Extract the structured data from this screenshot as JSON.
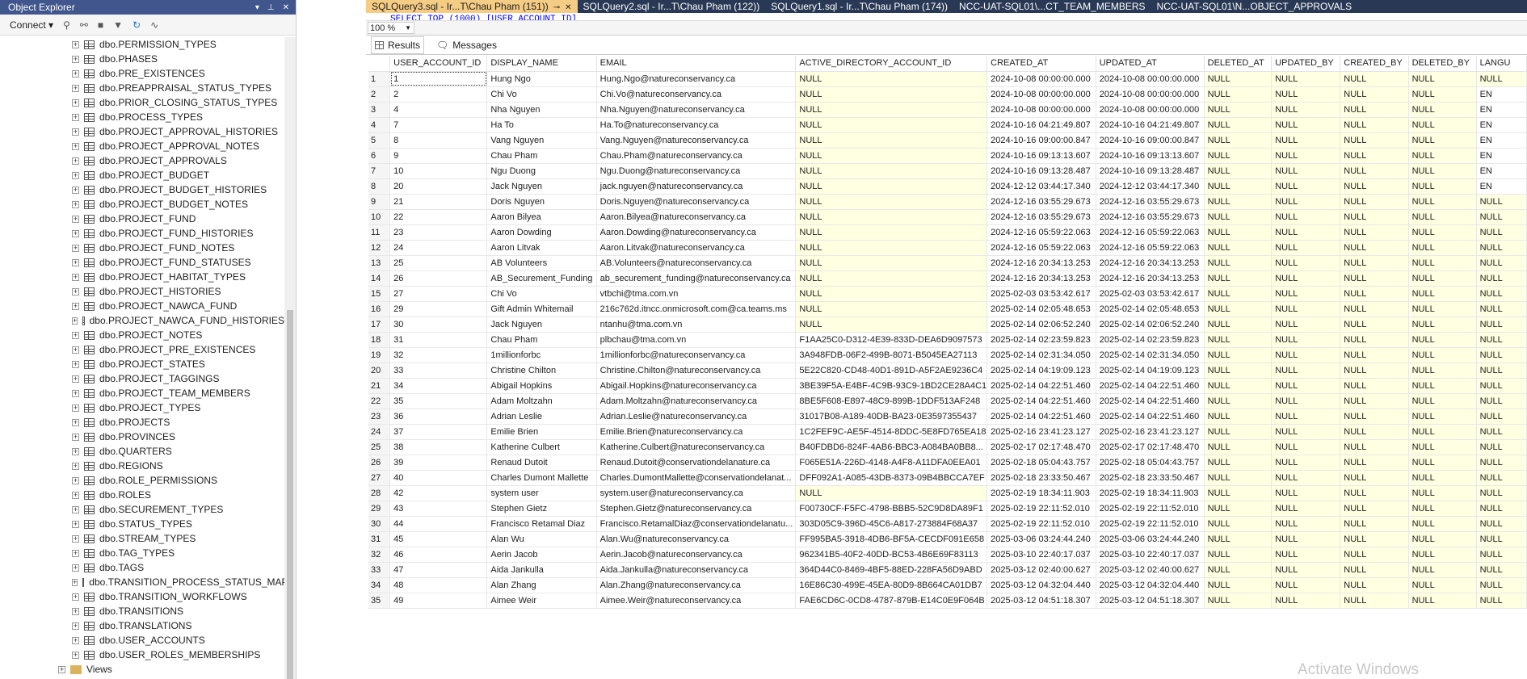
{
  "object_explorer": {
    "title": "Object Explorer",
    "connect_label": "Connect",
    "tables": [
      "dbo.PERMISSION_TYPES",
      "dbo.PHASES",
      "dbo.PRE_EXISTENCES",
      "dbo.PREAPPRAISAL_STATUS_TYPES",
      "dbo.PRIOR_CLOSING_STATUS_TYPES",
      "dbo.PROCESS_TYPES",
      "dbo.PROJECT_APPROVAL_HISTORIES",
      "dbo.PROJECT_APPROVAL_NOTES",
      "dbo.PROJECT_APPROVALS",
      "dbo.PROJECT_BUDGET",
      "dbo.PROJECT_BUDGET_HISTORIES",
      "dbo.PROJECT_BUDGET_NOTES",
      "dbo.PROJECT_FUND",
      "dbo.PROJECT_FUND_HISTORIES",
      "dbo.PROJECT_FUND_NOTES",
      "dbo.PROJECT_FUND_STATUSES",
      "dbo.PROJECT_HABITAT_TYPES",
      "dbo.PROJECT_HISTORIES",
      "dbo.PROJECT_NAWCA_FUND",
      "dbo.PROJECT_NAWCA_FUND_HISTORIES",
      "dbo.PROJECT_NOTES",
      "dbo.PROJECT_PRE_EXISTENCES",
      "dbo.PROJECT_STATES",
      "dbo.PROJECT_TAGGINGS",
      "dbo.PROJECT_TEAM_MEMBERS",
      "dbo.PROJECT_TYPES",
      "dbo.PROJECTS",
      "dbo.PROVINCES",
      "dbo.QUARTERS",
      "dbo.REGIONS",
      "dbo.ROLE_PERMISSIONS",
      "dbo.ROLES",
      "dbo.SECUREMENT_TYPES",
      "dbo.STATUS_TYPES",
      "dbo.STREAM_TYPES",
      "dbo.TAG_TYPES",
      "dbo.TAGS",
      "dbo.TRANSITION_PROCESS_STATUS_MAPPINGS",
      "dbo.TRANSITION_WORKFLOWS",
      "dbo.TRANSITIONS",
      "dbo.TRANSLATIONS",
      "dbo.USER_ACCOUNTS",
      "dbo.USER_ROLES_MEMBERSHIPS"
    ],
    "views_label": "Views"
  },
  "tabs": [
    {
      "label": "SQLQuery3.sql - Ir...T\\Chau Pham (151))",
      "active": true
    },
    {
      "label": "SQLQuery2.sql - Ir...T\\Chau Pham (122))",
      "active": false
    },
    {
      "label": "SQLQuery1.sql - Ir...T\\Chau Pham (174))",
      "active": false
    },
    {
      "label": "NCC-UAT-SQL01\\...CT_TEAM_MEMBERS",
      "active": false
    },
    {
      "label": "NCC-UAT-SQL01\\N...OBJECT_APPROVALS",
      "active": false
    }
  ],
  "editor_text": "SELECT TOP (1000) [USER_ACCOUNT_ID]",
  "zoom": "100 %",
  "result_tabs": {
    "results": "Results",
    "messages": "Messages"
  },
  "grid": {
    "columns": [
      "USER_ACCOUNT_ID",
      "DISPLAY_NAME",
      "EMAIL",
      "ACTIVE_DIRECTORY_ACCOUNT_ID",
      "CREATED_AT",
      "UPDATED_AT",
      "DELETED_AT",
      "UPDATED_BY",
      "CREATED_BY",
      "DELETED_BY",
      "LANGU"
    ],
    "rows": [
      [
        "1",
        "Hung Ngo",
        "Hung.Ngo@natureconservancy.ca",
        "NULL",
        "2024-10-08 00:00:00.000",
        "2024-10-08 00:00:00.000",
        "NULL",
        "NULL",
        "NULL",
        "NULL",
        "NULL"
      ],
      [
        "2",
        "Chi Vo",
        "Chi.Vo@natureconservancy.ca",
        "NULL",
        "2024-10-08 00:00:00.000",
        "2024-10-08 00:00:00.000",
        "NULL",
        "NULL",
        "NULL",
        "NULL",
        "EN"
      ],
      [
        "4",
        "Nha Nguyen",
        "Nha.Nguyen@natureconservancy.ca",
        "NULL",
        "2024-10-08 00:00:00.000",
        "2024-10-08 00:00:00.000",
        "NULL",
        "NULL",
        "NULL",
        "NULL",
        "EN"
      ],
      [
        "7",
        "Ha To",
        "Ha.To@natureconservancy.ca",
        "NULL",
        "2024-10-16 04:21:49.807",
        "2024-10-16 04:21:49.807",
        "NULL",
        "NULL",
        "NULL",
        "NULL",
        "EN"
      ],
      [
        "8",
        "Vang Nguyen",
        "Vang.Nguyen@natureconservancy.ca",
        "NULL",
        "2024-10-16 09:00:00.847",
        "2024-10-16 09:00:00.847",
        "NULL",
        "NULL",
        "NULL",
        "NULL",
        "EN"
      ],
      [
        "9",
        "Chau Pham",
        "Chau.Pham@natureconservancy.ca",
        "NULL",
        "2024-10-16 09:13:13.607",
        "2024-10-16 09:13:13.607",
        "NULL",
        "NULL",
        "NULL",
        "NULL",
        "EN"
      ],
      [
        "10",
        "Ngu Duong",
        "Ngu.Duong@natureconservancy.ca",
        "NULL",
        "2024-10-16 09:13:28.487",
        "2024-10-16 09:13:28.487",
        "NULL",
        "NULL",
        "NULL",
        "NULL",
        "EN"
      ],
      [
        "20",
        "Jack Nguyen",
        "jack.nguyen@natureconservancy.ca",
        "NULL",
        "2024-12-12 03:44:17.340",
        "2024-12-12 03:44:17.340",
        "NULL",
        "NULL",
        "NULL",
        "NULL",
        "EN"
      ],
      [
        "21",
        "Doris Nguyen",
        "Doris.Nguyen@natureconservancy.ca",
        "NULL",
        "2024-12-16 03:55:29.673",
        "2024-12-16 03:55:29.673",
        "NULL",
        "NULL",
        "NULL",
        "NULL",
        "NULL"
      ],
      [
        "22",
        "Aaron Bilyea",
        "Aaron.Bilyea@natureconservancy.ca",
        "NULL",
        "2024-12-16 03:55:29.673",
        "2024-12-16 03:55:29.673",
        "NULL",
        "NULL",
        "NULL",
        "NULL",
        "NULL"
      ],
      [
        "23",
        "Aaron Dowding",
        "Aaron.Dowding@natureconservancy.ca",
        "NULL",
        "2024-12-16 05:59:22.063",
        "2024-12-16 05:59:22.063",
        "NULL",
        "NULL",
        "NULL",
        "NULL",
        "NULL"
      ],
      [
        "24",
        "Aaron Litvak",
        "Aaron.Litvak@natureconservancy.ca",
        "NULL",
        "2024-12-16 05:59:22.063",
        "2024-12-16 05:59:22.063",
        "NULL",
        "NULL",
        "NULL",
        "NULL",
        "NULL"
      ],
      [
        "25",
        "AB Volunteers",
        "AB.Volunteers@natureconservancy.ca",
        "NULL",
        "2024-12-16 20:34:13.253",
        "2024-12-16 20:34:13.253",
        "NULL",
        "NULL",
        "NULL",
        "NULL",
        "NULL"
      ],
      [
        "26",
        "AB_Securement_Funding",
        "ab_securement_funding@natureconservancy.ca",
        "NULL",
        "2024-12-16 20:34:13.253",
        "2024-12-16 20:34:13.253",
        "NULL",
        "NULL",
        "NULL",
        "NULL",
        "NULL"
      ],
      [
        "27",
        "Chi Vo",
        "vtbchi@tma.com.vn",
        "NULL",
        "2025-02-03 03:53:42.617",
        "2025-02-03 03:53:42.617",
        "NULL",
        "NULL",
        "NULL",
        "NULL",
        "NULL"
      ],
      [
        "29",
        "Gift Admin Whitemail",
        "216c762d.itncc.onmicrosoft.com@ca.teams.ms",
        "NULL",
        "2025-02-14 02:05:48.653",
        "2025-02-14 02:05:48.653",
        "NULL",
        "NULL",
        "NULL",
        "NULL",
        "NULL"
      ],
      [
        "30",
        "Jack Nguyen",
        "ntanhu@tma.com.vn",
        "NULL",
        "2025-02-14 02:06:52.240",
        "2025-02-14 02:06:52.240",
        "NULL",
        "NULL",
        "NULL",
        "NULL",
        "NULL"
      ],
      [
        "31",
        "Chau Pham",
        "plbchau@tma.com.vn",
        "F1AA25C0-D312-4E39-833D-DEA6D9097573",
        "2025-02-14 02:23:59.823",
        "2025-02-14 02:23:59.823",
        "NULL",
        "NULL",
        "NULL",
        "NULL",
        "NULL"
      ],
      [
        "32",
        "1millionforbc",
        "1millionforbc@natureconservancy.ca",
        "3A948FDB-06F2-499B-8071-B5045EA27113",
        "2025-02-14 02:31:34.050",
        "2025-02-14 02:31:34.050",
        "NULL",
        "NULL",
        "NULL",
        "NULL",
        "NULL"
      ],
      [
        "33",
        "Christine Chilton",
        "Christine.Chilton@natureconservancy.ca",
        "5E22C820-CD48-40D1-891D-A5F2AE9236C4",
        "2025-02-14 04:19:09.123",
        "2025-02-14 04:19:09.123",
        "NULL",
        "NULL",
        "NULL",
        "NULL",
        "NULL"
      ],
      [
        "34",
        "Abigail Hopkins",
        "Abigail.Hopkins@natureconservancy.ca",
        "3BE39F5A-E4BF-4C9B-93C9-1BD2CE28A4C1",
        "2025-02-14 04:22:51.460",
        "2025-02-14 04:22:51.460",
        "NULL",
        "NULL",
        "NULL",
        "NULL",
        "NULL"
      ],
      [
        "35",
        "Adam Moltzahn",
        "Adam.Moltzahn@natureconservancy.ca",
        "8BE5F608-E897-48C9-899B-1DDF513AF248",
        "2025-02-14 04:22:51.460",
        "2025-02-14 04:22:51.460",
        "NULL",
        "NULL",
        "NULL",
        "NULL",
        "NULL"
      ],
      [
        "36",
        "Adrian Leslie",
        "Adrian.Leslie@natureconservancy.ca",
        "31017B08-A189-40DB-BA23-0E3597355437",
        "2025-02-14 04:22:51.460",
        "2025-02-14 04:22:51.460",
        "NULL",
        "NULL",
        "NULL",
        "NULL",
        "NULL"
      ],
      [
        "37",
        "Emilie Brien",
        "Emilie.Brien@natureconservancy.ca",
        "1C2FEF9C-AE5F-4514-8DDC-5E8FD765EA18",
        "2025-02-16 23:41:23.127",
        "2025-02-16 23:41:23.127",
        "NULL",
        "NULL",
        "NULL",
        "NULL",
        "NULL"
      ],
      [
        "38",
        "Katherine Culbert",
        "Katherine.Culbert@natureconservancy.ca",
        "B40FDBD6-824F-4AB6-BBC3-A084BA0BB8...",
        "2025-02-17 02:17:48.470",
        "2025-02-17 02:17:48.470",
        "NULL",
        "NULL",
        "NULL",
        "NULL",
        "NULL"
      ],
      [
        "39",
        "Renaud Dutoit",
        "Renaud.Dutoit@conservationdelanature.ca",
        "F065E51A-226D-4148-A4F8-A11DFA0EEA01",
        "2025-02-18 05:04:43.757",
        "2025-02-18 05:04:43.757",
        "NULL",
        "NULL",
        "NULL",
        "NULL",
        "NULL"
      ],
      [
        "40",
        "Charles Dumont Mallette",
        "Charles.DumontMallette@conservationdelanat...",
        "DFF092A1-A085-43DB-8373-09B4BBCCA7EF",
        "2025-02-18 23:33:50.467",
        "2025-02-18 23:33:50.467",
        "NULL",
        "NULL",
        "NULL",
        "NULL",
        "NULL"
      ],
      [
        "42",
        "system user",
        "system.user@natureconservancy.ca",
        "NULL",
        "2025-02-19 18:34:11.903",
        "2025-02-19 18:34:11.903",
        "NULL",
        "NULL",
        "NULL",
        "NULL",
        "NULL"
      ],
      [
        "43",
        "Stephen Gietz",
        "Stephen.Gietz@natureconservancy.ca",
        "F00730CF-F5FC-4798-BBB5-52C9D8DA89F1",
        "2025-02-19 22:11:52.010",
        "2025-02-19 22:11:52.010",
        "NULL",
        "NULL",
        "NULL",
        "NULL",
        "NULL"
      ],
      [
        "44",
        "Francisco Retamal Diaz",
        "Francisco.RetamalDiaz@conservationdelanatu...",
        "303D05C9-396D-45C6-A817-273884F68A37",
        "2025-02-19 22:11:52.010",
        "2025-02-19 22:11:52.010",
        "NULL",
        "NULL",
        "NULL",
        "NULL",
        "NULL"
      ],
      [
        "45",
        "Alan Wu",
        "Alan.Wu@natureconservancy.ca",
        "FF995BA5-3918-4DB6-BF5A-CECDF091E658",
        "2025-03-06 03:24:44.240",
        "2025-03-06 03:24:44.240",
        "NULL",
        "NULL",
        "NULL",
        "NULL",
        "NULL"
      ],
      [
        "46",
        "Aerin Jacob",
        "Aerin.Jacob@natureconservancy.ca",
        "962341B5-40F2-40DD-BC53-4B6E69F83113",
        "2025-03-10 22:40:17.037",
        "2025-03-10 22:40:17.037",
        "NULL",
        "NULL",
        "NULL",
        "NULL",
        "NULL"
      ],
      [
        "47",
        "Aida Jankulla",
        "Aida.Jankulla@natureconservancy.ca",
        "364D44C0-8469-4BF5-88ED-228FA56D9ABD",
        "2025-03-12 02:40:00.627",
        "2025-03-12 02:40:00.627",
        "NULL",
        "NULL",
        "NULL",
        "NULL",
        "NULL"
      ],
      [
        "48",
        "Alan Zhang",
        "Alan.Zhang@natureconservancy.ca",
        "16E86C30-499E-45EA-80D9-8B664CA01DB7",
        "2025-03-12 04:32:04.440",
        "2025-03-12 04:32:04.440",
        "NULL",
        "NULL",
        "NULL",
        "NULL",
        "NULL"
      ],
      [
        "49",
        "Aimee Weir",
        "Aimee.Weir@natureconservancy.ca",
        "FAE6CD6C-0CD8-4787-879B-E14C0E9F064B",
        "2025-03-12 04:51:18.307",
        "2025-03-12 04:51:18.307",
        "NULL",
        "NULL",
        "NULL",
        "NULL",
        "NULL"
      ]
    ]
  },
  "watermark": "Activate Windows"
}
